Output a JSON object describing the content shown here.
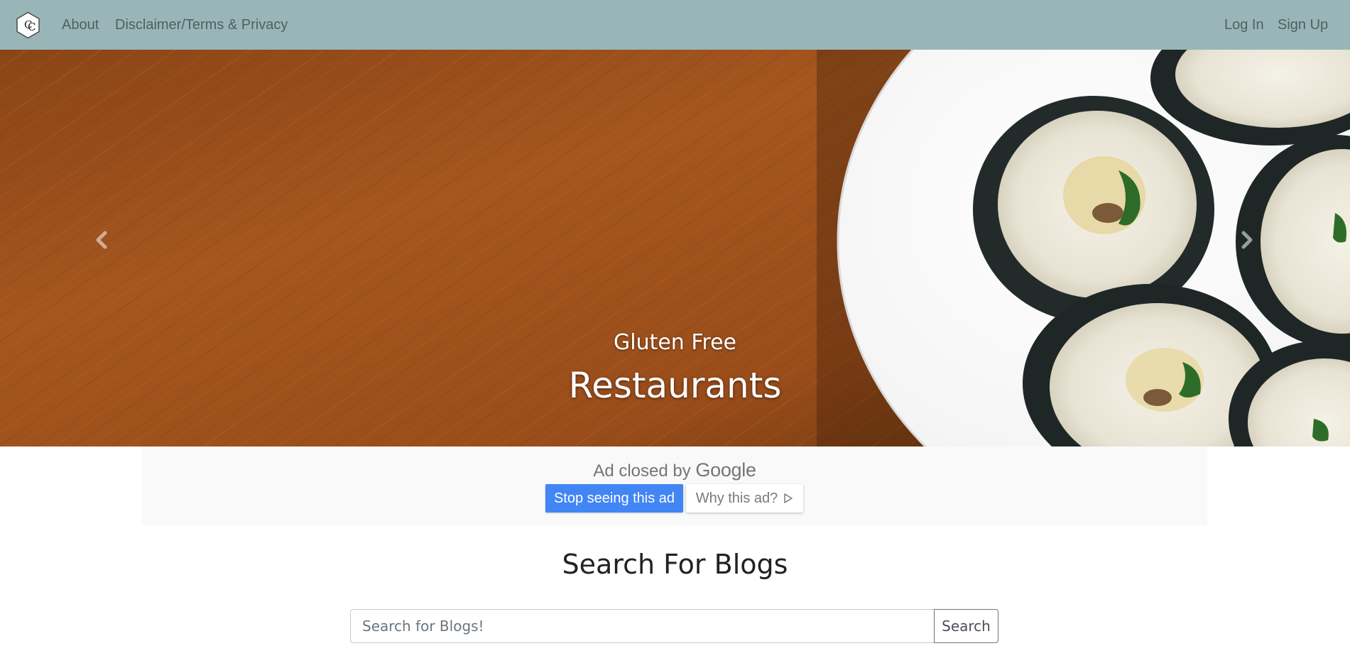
{
  "navbar": {
    "brand_logo_text": "CC",
    "about": "About",
    "terms": "Disclaimer/Terms & Privacy",
    "login": "Log In",
    "signup": "Sign Up",
    "background_color": "#99b5b8"
  },
  "carousel": {
    "caption_sub": "Gluten Free",
    "caption_main": "Restaurants",
    "prev_icon": "chevron-left-icon",
    "next_icon": "chevron-right-icon",
    "image_subject": "sushi rolls on white plate over wooden table"
  },
  "ad": {
    "closed_text": "Ad closed by",
    "google_text": "Google",
    "stop_button": "Stop seeing this ad",
    "why_button": "Why this ad?",
    "why_icon": "adchoices-play-icon",
    "accent_color": "#4285f4"
  },
  "search": {
    "title": "Search For Blogs",
    "placeholder": "Search for Blogs!",
    "button": "Search"
  }
}
